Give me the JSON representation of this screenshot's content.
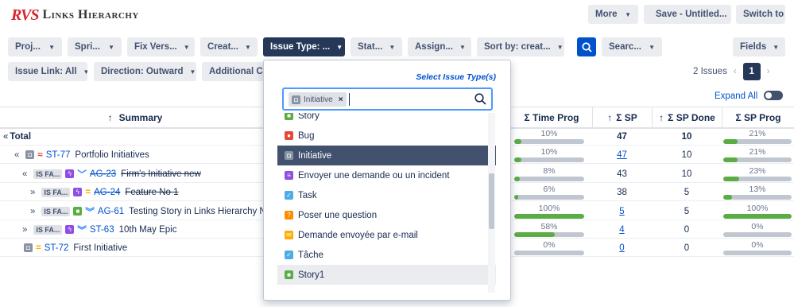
{
  "app": {
    "brand": "RVS",
    "title": "Links Hierarchy"
  },
  "top_buttons": {
    "more": "More",
    "save": "Save - Untitled...",
    "switch": "Switch to"
  },
  "filters": [
    "Proj...",
    "Spri...",
    "Fix Vers...",
    "Creat...",
    "Issue Type: ...",
    "Stat...",
    "Assign...",
    "Sort by: creat..."
  ],
  "search": {
    "label": "Searc..."
  },
  "fields": "Fields",
  "filters2": {
    "issue_link": "Issue Link: All",
    "direction": "Direction: Outward",
    "additional": "Additional Crit"
  },
  "pagination": {
    "count": "2 Issues",
    "page": "1"
  },
  "expand_all": "Expand All",
  "columns": {
    "summary": "Summary",
    "time_prog": "Σ Time Prog",
    "sp": "Σ SP",
    "sp_done": "Σ SP Done",
    "sp_prog": "Σ SP Prog"
  },
  "total_label": "Total",
  "rows": [
    {
      "key": "",
      "summary": "",
      "time_pct": "10%",
      "time_fill": 0.1,
      "sp": "47",
      "sp_done": "10",
      "sp_pct": "21%",
      "sp_fill": 0.21
    },
    {
      "key": "ST-77",
      "summary": "Portfolio Initiatives",
      "time_pct": "10%",
      "time_fill": 0.1,
      "sp": "47",
      "sp_done": "10",
      "sp_pct": "21%",
      "sp_fill": 0.21
    },
    {
      "badge": "IS FA...",
      "key": "AG-23",
      "summary": "Firm's Initiative new",
      "time_pct": "8%",
      "time_fill": 0.08,
      "sp": "43",
      "sp_done": "10",
      "sp_pct": "23%",
      "sp_fill": 0.23
    },
    {
      "badge": "IS FA...",
      "key": "AG-24",
      "summary": "Feature No 1",
      "time_pct": "6%",
      "time_fill": 0.06,
      "sp": "38",
      "sp_done": "5",
      "sp_pct": "13%",
      "sp_fill": 0.13
    },
    {
      "badge": "IS FA...",
      "key": "AG-61",
      "summary": "Testing Story in Links Hierarchy New",
      "time_pct": "100%",
      "time_fill": 1.0,
      "sp": "5",
      "sp_done": "5",
      "sp_pct": "100%",
      "sp_fill": 1.0
    },
    {
      "badge": "IS FA...",
      "key": "ST-63",
      "summary": "10th May Epic",
      "time_pct": "58%",
      "time_fill": 0.58,
      "sp": "4",
      "sp_done": "0",
      "sp_pct": "0%",
      "sp_fill": 0
    },
    {
      "key": "ST-72",
      "summary": "First Initiative",
      "time_pct": "0%",
      "time_fill": 0,
      "sp": "0",
      "sp_done": "0",
      "sp_pct": "0%",
      "sp_fill": 0
    }
  ],
  "dropdown": {
    "title": "Select Issue Type(s)",
    "chip": "Initiative",
    "options": [
      "Story",
      "Bug",
      "Initiative",
      "Envoyer une demande ou un incident",
      "Task",
      "Poser une question",
      "Demande envoyée par e-mail",
      "Tâche",
      "Story1"
    ],
    "selected": "Initiative"
  },
  "colors": {
    "accent": "#0052cc",
    "dark": "#253858",
    "progress": "#5aac44",
    "brand": "#d8262d"
  }
}
